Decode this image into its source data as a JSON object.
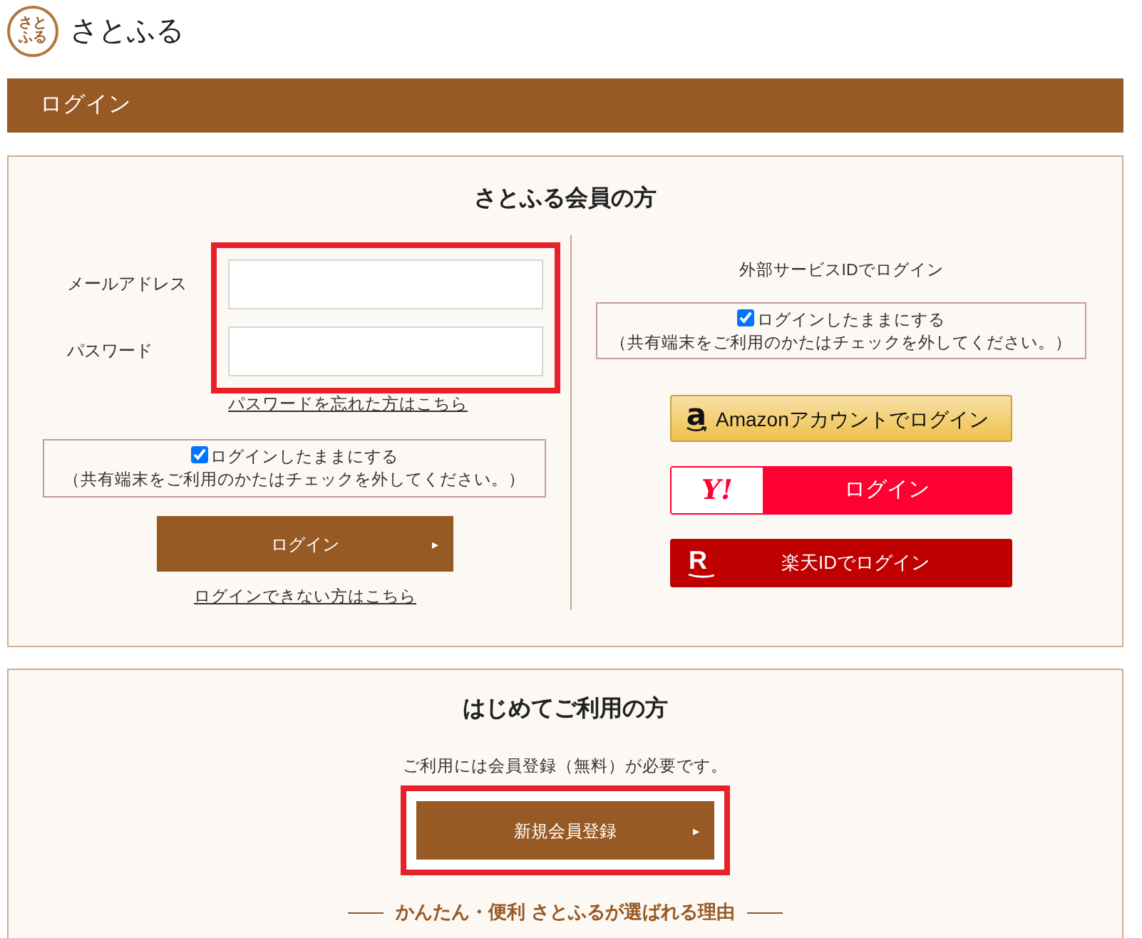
{
  "header": {
    "seal_text": "さとふる",
    "logo_text": "さとふる"
  },
  "page_title": "ログイン",
  "member_login": {
    "heading": "さとふる会員の方",
    "fields_highlighted": true,
    "fields": [
      {
        "label": "メールアドレス"
      },
      {
        "label": "パスワード"
      }
    ],
    "forgot_link": "パスワードを忘れた方はこちら",
    "remember": {
      "checked": true,
      "label": "ログインしたままにする",
      "note": "（共有端末をご利用のかたはチェックを外してください。）"
    },
    "login_button": {
      "label": "ログイン",
      "arrow": "▸"
    },
    "help_link": "ログインできない方はこちら"
  },
  "external_login": {
    "heading": "外部サービスIDでログイン",
    "remember": {
      "checked": true,
      "label": "ログインしたままにする",
      "note": "（共有端末をご利用のかたはチェックを外してください。）"
    },
    "buttons": [
      {
        "kind": "amazon",
        "logo_text": "a",
        "label": "Amazonアカウントでログイン"
      },
      {
        "kind": "yahoo",
        "logo_text": "Y!",
        "label": "ログイン"
      },
      {
        "kind": "rakuten",
        "logo_text": "R",
        "label": "楽天IDでログイン"
      }
    ]
  },
  "first_time": {
    "heading": "はじめてご利用の方",
    "note": "ご利用には会員登録（無料）が必要です。",
    "register_button": {
      "label": "新規会員登録",
      "arrow": "▸",
      "highlighted": true
    },
    "reasons_heading": "かんたん・便利 さとふるが選ばれる理由"
  }
}
